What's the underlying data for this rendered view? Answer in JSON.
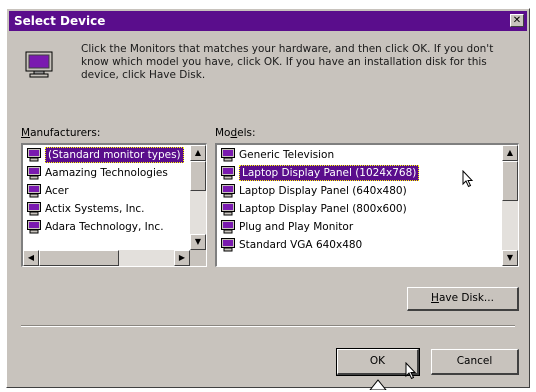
{
  "window": {
    "title": "Select Device"
  },
  "icons": {
    "close": "close-icon",
    "monitor": "monitor-icon",
    "list_item": "monitor-icon"
  },
  "instructions": "Click the Monitors that matches your hardware, and then click OK. If you don't know which model you have, click OK. If you have an installation disk for this device, click Have Disk.",
  "manufacturers": {
    "label_prefix": "M",
    "label_rest": "anufacturers:",
    "items": [
      "(Standard monitor types)",
      "Aamazing Technologies",
      "Acer",
      "Actix Systems, Inc.",
      "Adara Technology, Inc."
    ],
    "selected_index": 0
  },
  "models": {
    "label_prefix": "Mo",
    "label_underline": "d",
    "label_rest": "els:",
    "items": [
      "Generic Television",
      "Laptop Display Panel (1024x768)",
      "Laptop Display Panel (640x480)",
      "Laptop Display Panel (800x600)",
      "Plug and Play Monitor",
      "Standard VGA 640x480"
    ],
    "selected_index": 1
  },
  "buttons": {
    "have_disk_underline": "H",
    "have_disk_rest": "ave Disk...",
    "ok": "OK",
    "cancel": "Cancel"
  },
  "colors": {
    "title_bar": "#5a0d8c",
    "dialog_face": "#c8c3bd",
    "selection": "#5a0d8c"
  }
}
